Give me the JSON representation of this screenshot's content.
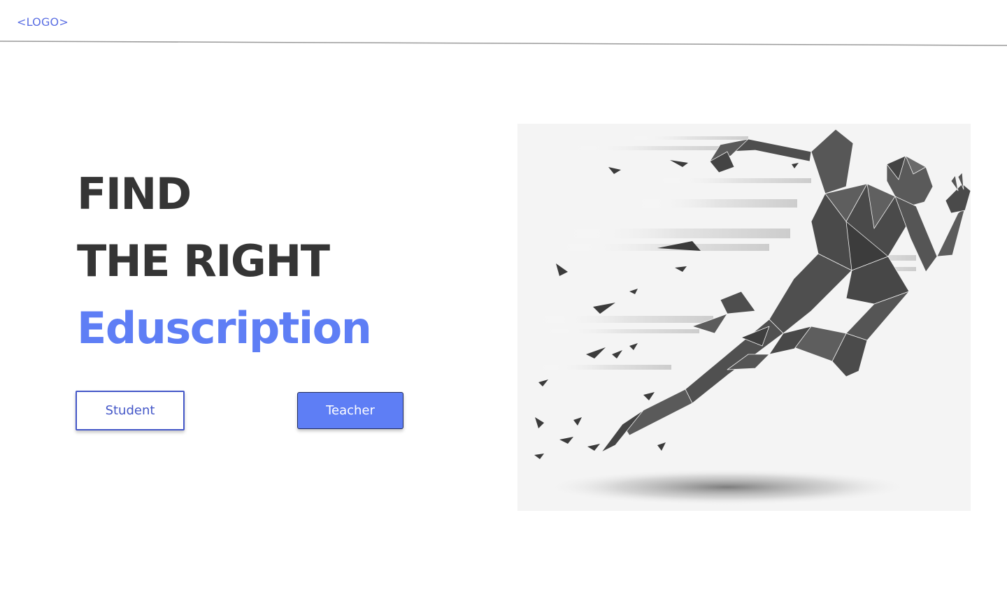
{
  "header": {
    "logo_text": "<LOGO>"
  },
  "hero": {
    "line1": "FIND",
    "line2": "THE RIGHT",
    "line3": "Eduscription",
    "image_subject": "running-figure-illustration"
  },
  "actions": {
    "student_label": "Student",
    "teacher_label": "Teacher"
  },
  "colors": {
    "accent": "#5e7ef5",
    "outline": "#4457c8",
    "heading": "#353535",
    "image_bg": "#f4f4f4"
  }
}
